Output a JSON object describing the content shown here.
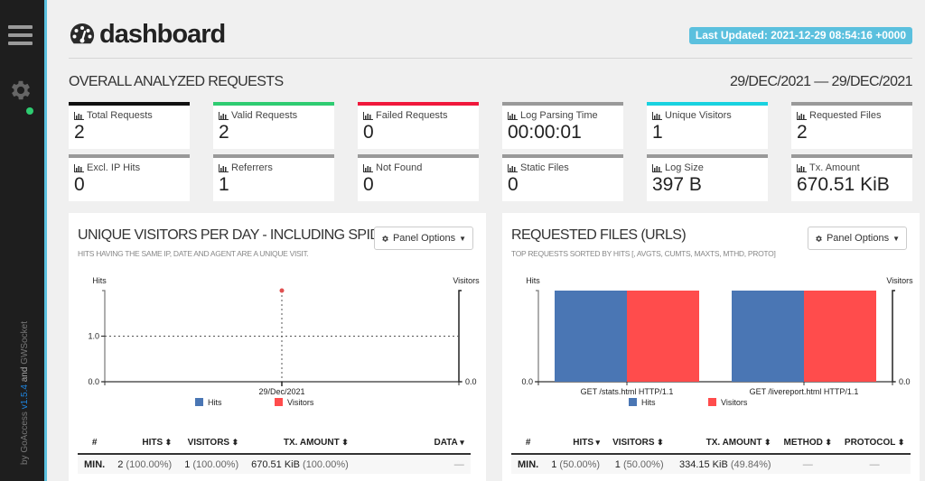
{
  "sidebar": {
    "menu_icon": "hamburger-menu-icon",
    "settings_icon": "gear-icon",
    "status_color": "#2ecc71",
    "credits": {
      "prefix": "by GoAccess ",
      "version": "v1.5.4",
      "and": " and ",
      "suffix": "GWSocket"
    }
  },
  "header": {
    "logo_icon": "tachometer-icon",
    "title": "dashboard",
    "last_updated": "Last Updated: 2021-12-29 08:54:16 +0000"
  },
  "overall": {
    "title": "OVERALL ANALYZED REQUESTS",
    "date_range": "29/DEC/2021 — 29/DEC/2021",
    "cards": [
      {
        "label": "Total Requests",
        "value": "2",
        "accent": "#111111"
      },
      {
        "label": "Valid Requests",
        "value": "2",
        "accent": "#2ecc71"
      },
      {
        "label": "Failed Requests",
        "value": "0",
        "accent": "#f0173b"
      },
      {
        "label": "Log Parsing Time",
        "value": "00:00:01",
        "accent": "#999999"
      },
      {
        "label": "Unique Visitors",
        "value": "1",
        "accent": "#19d2e0"
      },
      {
        "label": "Requested Files",
        "value": "2",
        "accent": "#999999"
      },
      {
        "label": "Excl. IP Hits",
        "value": "0",
        "accent": "#999999"
      },
      {
        "label": "Referrers",
        "value": "1",
        "accent": "#999999"
      },
      {
        "label": "Not Found",
        "value": "0",
        "accent": "#999999"
      },
      {
        "label": "Static Files",
        "value": "0",
        "accent": "#999999"
      },
      {
        "label": "Log Size",
        "value": "397 B",
        "accent": "#999999"
      },
      {
        "label": "Tx. Amount",
        "value": "670.51 KiB",
        "accent": "#999999"
      }
    ]
  },
  "panels": [
    {
      "title": "UNIQUE VISITORS PER DAY - INCLUDING SPIDERS",
      "subtitle": "HITS HAVING THE SAME IP, DATE AND AGENT ARE A UNIQUE VISIT.",
      "options_label": "Panel Options",
      "table": {
        "headers": [
          "#",
          "HITS",
          "VISITORS",
          "TX. AMOUNT",
          "DATA"
        ],
        "sort_icons": [
          "",
          "⬍",
          "⬍",
          "⬍",
          "▾"
        ],
        "rows": [
          {
            "label": "MIN.",
            "hits": "2",
            "hits_pct": "(100.00%)",
            "visitors": "1",
            "visitors_pct": "(100.00%)",
            "tx": "670.51 KiB",
            "tx_pct": "(100.00%)",
            "data": "—"
          }
        ]
      }
    },
    {
      "title": "REQUESTED FILES (URLS)",
      "subtitle": "TOP REQUESTS SORTED BY HITS [, AVGTS, CUMTS, MAXTS, MTHD, PROTO]",
      "options_label": "Panel Options",
      "table": {
        "headers": [
          "#",
          "HITS",
          "VISITORS",
          "TX. AMOUNT",
          "METHOD",
          "PROTOCOL"
        ],
        "sort_icons": [
          "",
          "▾",
          "⬍",
          "⬍",
          "⬍",
          "⬍"
        ],
        "rows": [
          {
            "label": "MIN.",
            "hits": "1",
            "hits_pct": "(50.00%)",
            "visitors": "1",
            "visitors_pct": "(50.00%)",
            "tx": "334.15 KiB",
            "tx_pct": "(49.84%)",
            "method": "—",
            "protocol": "—"
          }
        ]
      }
    }
  ],
  "chart_data": [
    {
      "type": "line",
      "title": "UNIQUE VISITORS PER DAY - INCLUDING SPIDERS",
      "x": [
        "29/Dec/2021"
      ],
      "series": [
        {
          "name": "Hits",
          "values": [
            2
          ],
          "color": "#4a76b4"
        },
        {
          "name": "Visitors",
          "values": [
            1
          ],
          "color": "#ff4c4c"
        }
      ],
      "ylabel_left": "Hits",
      "ylabel_right": "Visitors",
      "yticks_left": [
        "0.0",
        "1.0"
      ],
      "yticks_right": [
        "0.0"
      ],
      "ylim": [
        0,
        2
      ],
      "legend": "bottom-center",
      "grid": true
    },
    {
      "type": "bar",
      "title": "REQUESTED FILES (URLS)",
      "categories": [
        "GET /stats.html HTTP/1.1",
        "GET /livereport.html HTTP/1.1"
      ],
      "series": [
        {
          "name": "Hits",
          "values": [
            1,
            1
          ],
          "color": "#4a76b4"
        },
        {
          "name": "Visitors",
          "values": [
            1,
            1
          ],
          "color": "#ff4c4c"
        }
      ],
      "ylabel_left": "Hits",
      "ylabel_right": "Visitors",
      "yticks_left": [
        "0.0"
      ],
      "yticks_right": [
        "0.0"
      ],
      "ylim": [
        0,
        1
      ],
      "legend": "bottom-center",
      "grid": false
    }
  ]
}
